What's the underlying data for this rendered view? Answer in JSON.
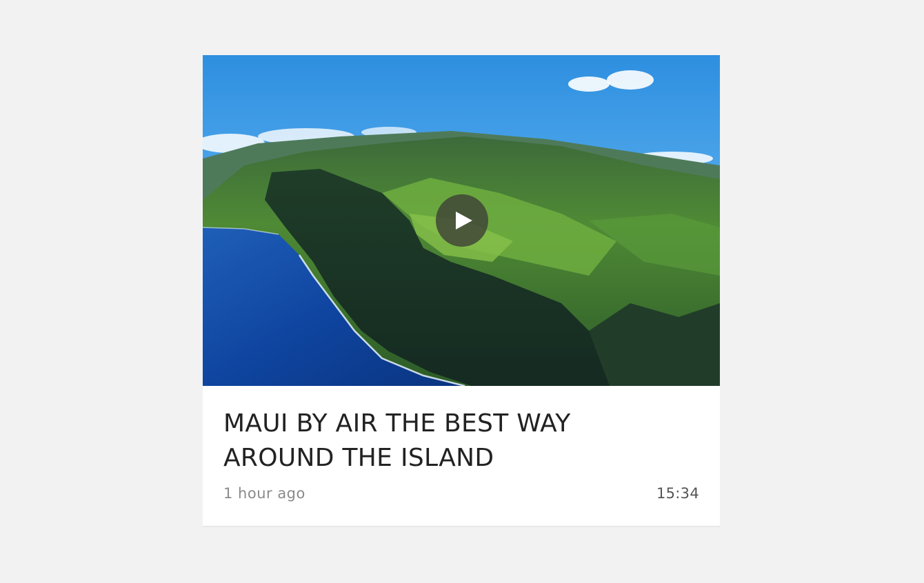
{
  "video_card": {
    "thumbnail_alt": "Aerial view of Maui sea cliffs",
    "play_icon": "play-icon",
    "title": "MAUI BY AIR THE BEST WAY AROUND THE ISLAND",
    "posted": "1 hour ago",
    "duration": "15:34"
  },
  "colors": {
    "background": "#f2f2f2",
    "card": "#ffffff",
    "title": "#222222",
    "meta_muted": "#8a8a8a",
    "duration": "#555555"
  }
}
